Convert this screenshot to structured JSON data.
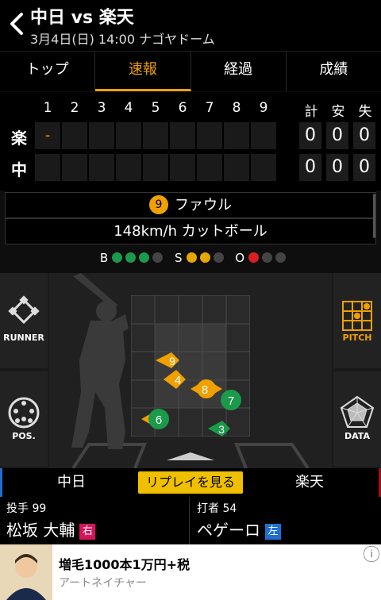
{
  "header": {
    "title": "中日 vs 楽天",
    "subtitle": "3月4日(日) 14:00 ナゴヤドーム"
  },
  "tabs": [
    "トップ",
    "速報",
    "経過",
    "成績"
  ],
  "active_tab_index": 1,
  "scoreboard": {
    "innings": [
      "1",
      "2",
      "3",
      "4",
      "5",
      "6",
      "7",
      "8",
      "9"
    ],
    "total_headers": [
      "計",
      "安",
      "失"
    ],
    "teams": [
      {
        "name": "楽",
        "innings": [
          "-",
          "",
          "",
          "",
          "",
          "",
          "",
          "",
          ""
        ],
        "totals": [
          "0",
          "0",
          "0"
        ]
      },
      {
        "name": "中",
        "innings": [
          "",
          "",
          "",
          "",
          "",
          "",
          "",
          "",
          ""
        ],
        "totals": [
          "0",
          "0",
          "0"
        ]
      }
    ]
  },
  "play": {
    "ball_number": "9",
    "result": "ファウル",
    "pitch": "148km/h カットボール"
  },
  "count": {
    "b_label": "B",
    "s_label": "S",
    "o_label": "O",
    "balls": 3,
    "strikes": 2,
    "outs": 1
  },
  "side_buttons": {
    "runner": "RUNNER",
    "pos": "POS.",
    "pitch": "PITCH",
    "data": "DATA"
  },
  "pitches": [
    {
      "n": "9",
      "color": "#f0a000"
    },
    {
      "n": "4",
      "color": "#f0a000"
    },
    {
      "n": "8",
      "color": "#f0a000"
    },
    {
      "n": "7",
      "color": "#1a9a4a"
    },
    {
      "n": "6",
      "color": "#1a9a4a"
    },
    {
      "n": "3",
      "color": "#1a9a4a"
    }
  ],
  "team_row": {
    "home": "中日",
    "replay": "リプレイを見る",
    "away": "楽天"
  },
  "players": {
    "pitcher_label": "投手 99",
    "pitcher_name": "松坂 大輔",
    "pitcher_hand": "右",
    "batter_label": "打者 54",
    "batter_name": "ペゲーロ",
    "batter_hand": "左"
  },
  "ad": {
    "headline": "増毛1000本1万円+税",
    "advertiser": "アートネイチャー"
  },
  "colors": {
    "accent": "#f0a000",
    "ball": "#1a9a4a",
    "strike": "#e6a800",
    "out": "#d92020",
    "right_badge": "#d4145a",
    "left_badge": "#1f6fd1"
  }
}
